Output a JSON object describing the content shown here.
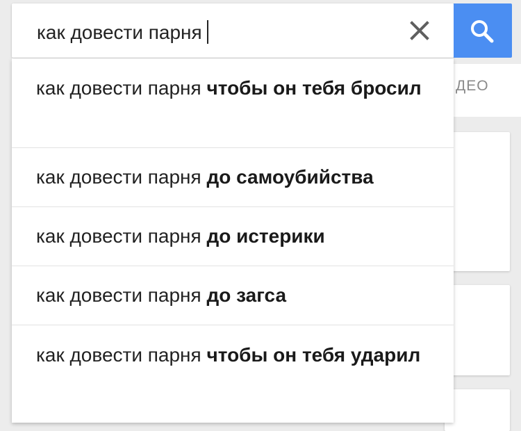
{
  "search": {
    "query": "как довести парня",
    "clear_icon": "close-icon",
    "search_icon": "search-icon",
    "button_color": "#4b8ef2"
  },
  "tabs": {
    "partial_label": "ДЕО"
  },
  "suggestions": [
    {
      "prefix": "как довести парня",
      "completion": "чтобы он тебя бросил"
    },
    {
      "prefix": "как довести парня",
      "completion": "до самоубийства"
    },
    {
      "prefix": "как довести парня",
      "completion": "до истерики"
    },
    {
      "prefix": "как довести парня",
      "completion": "до загса"
    },
    {
      "prefix": "как довести парня",
      "completion": "чтобы он тебя ударил"
    }
  ]
}
